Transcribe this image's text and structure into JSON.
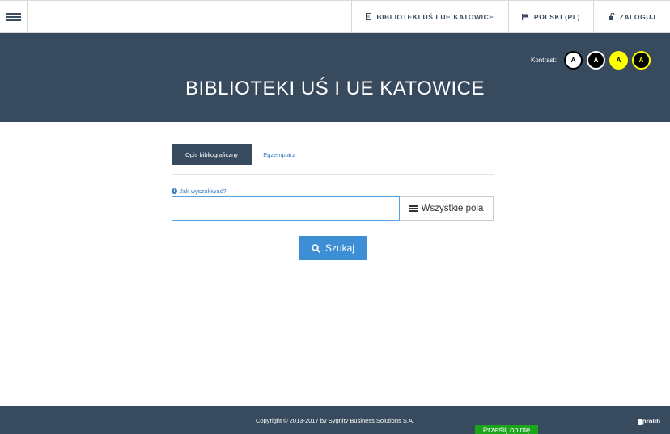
{
  "topbar": {
    "libraries_label": "BIBLIOTEKI UŚ I UE KATOWICE",
    "language_label": "POLSKI (PL)",
    "login_label": "ZALOGUJ"
  },
  "header": {
    "title": "BIBLIOTEKI UŚ I UE KATOWICE",
    "contrast_label": "Kontrast:",
    "contrast_options": [
      "A",
      "A",
      "A",
      "A"
    ]
  },
  "tabs": [
    {
      "label": "Opis bibliograficzny",
      "active": true
    },
    {
      "label": "Egzemplarz",
      "active": false
    }
  ],
  "search": {
    "help_label": "Jak wyszukiwać?",
    "input_value": "",
    "field_selected": "Wszystkie pola",
    "button_label": "Szukaj"
  },
  "footer": {
    "copyright": "Copyright © 2013-2017 by Sygnity Business Solutions S.A.",
    "feedback_label": "Prześlij opinię",
    "brand": "prolib"
  },
  "colors": {
    "header_bg": "#374a5e",
    "accent_blue": "#3d8ed4",
    "link_blue": "#3a7bc4",
    "feedback_green": "#1aa51a"
  }
}
